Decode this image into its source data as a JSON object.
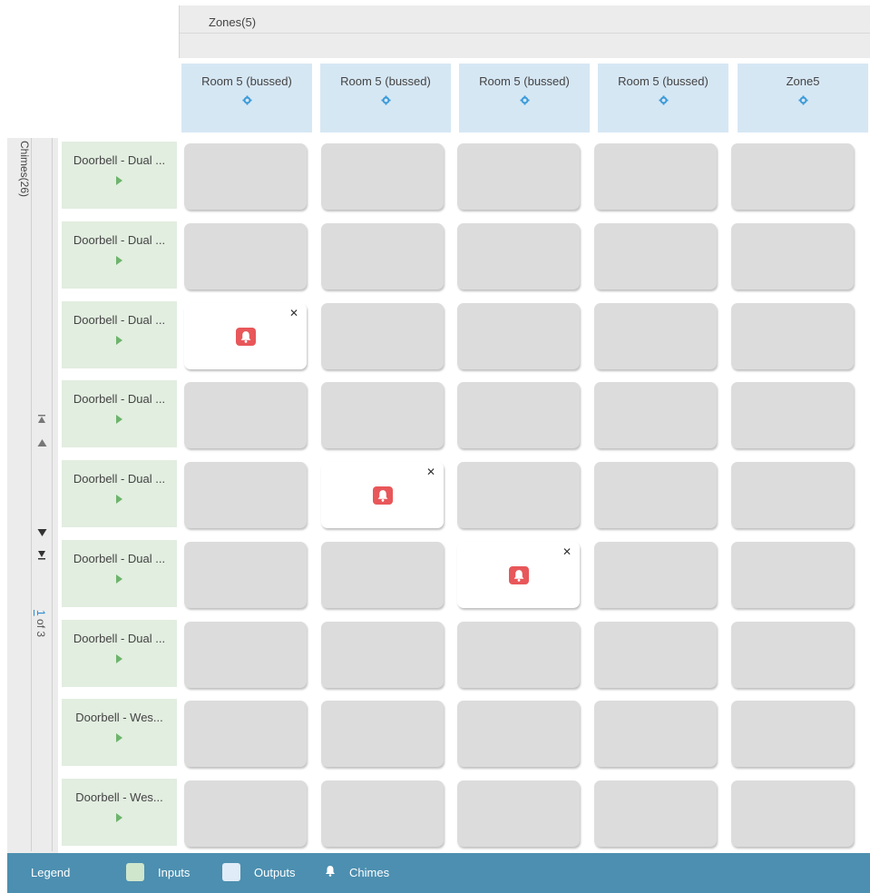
{
  "zones_header": "Zones(5)",
  "chimes_header": "Chimes(26)",
  "pager": {
    "current": "1",
    "of_label": "of 3"
  },
  "outputs": [
    {
      "label": "Room 5 (bussed)"
    },
    {
      "label": "Room 5 (bussed)"
    },
    {
      "label": "Room 5 (bussed)"
    },
    {
      "label": "Room 5 (bussed)"
    },
    {
      "label": "Zone5"
    }
  ],
  "inputs": [
    {
      "label": "Doorbell - Dual ..."
    },
    {
      "label": "Doorbell - Dual ..."
    },
    {
      "label": "Doorbell - Dual ..."
    },
    {
      "label": "Doorbell - Dual ..."
    },
    {
      "label": "Doorbell - Dual ..."
    },
    {
      "label": "Doorbell - Dual ..."
    },
    {
      "label": "Doorbell - Dual ..."
    },
    {
      "label": "Doorbell - Wes..."
    },
    {
      "label": "Doorbell - Wes..."
    }
  ],
  "active_routes": [
    {
      "row": 2,
      "col": 0
    },
    {
      "row": 4,
      "col": 1
    },
    {
      "row": 5,
      "col": 2
    }
  ],
  "colors": {
    "input_bg": "#e2eee0",
    "output_bg": "#d6e7f4",
    "chime_red": "#e8575a",
    "legend_bg": "#4c8fb0"
  },
  "legend": {
    "title": "Legend",
    "inputs_label": "Inputs",
    "outputs_label": "Outputs",
    "chimes_label": "Chimes"
  },
  "icons": {
    "output_settings": "gear-icon",
    "input_play": "play-icon",
    "route_chime": "bell-icon",
    "route_remove": "close-icon"
  }
}
